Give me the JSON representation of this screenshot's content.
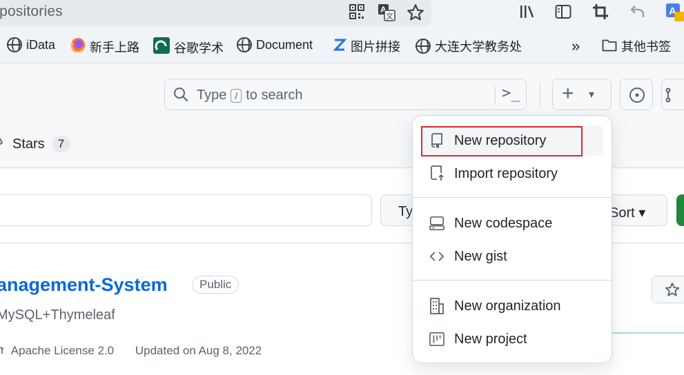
{
  "browser": {
    "url_fragment": "repositories",
    "bookmarks": [
      {
        "label": "iData",
        "icon": "globe-icon"
      },
      {
        "label": "新手上路",
        "icon": "firefox-icon"
      },
      {
        "label": "谷歌学术",
        "icon": "scholar-icon"
      },
      {
        "label": "Document",
        "icon": "globe-icon"
      },
      {
        "label": "图片拼接",
        "icon": "z-icon"
      },
      {
        "label": "大连大学教务处",
        "icon": "globe-icon"
      }
    ],
    "other_bookmarks": "其他书签",
    "overflow": "»"
  },
  "header": {
    "search_type": "Type",
    "search_key": "/",
    "search_rest": "to search",
    "command_icon": ">_",
    "plus": "+",
    "caret": "▾"
  },
  "tabs": {
    "stars_label": "Stars",
    "stars_count": "7"
  },
  "filters": {
    "type_label": "Ty",
    "sort_label": "Sort ▾"
  },
  "repo": {
    "name": "anagement-System",
    "visibility": "Public",
    "description": "MySQL+Thymeleaf",
    "license": "Apache License 2.0",
    "updated": "Updated on Aug 8, 2022"
  },
  "menu": {
    "items": [
      {
        "label": "New repository",
        "icon": "repo-icon"
      },
      {
        "label": "Import repository",
        "icon": "repo-push-icon"
      },
      {
        "label": "New codespace",
        "icon": "codespace-icon"
      },
      {
        "label": "New gist",
        "icon": "code-icon"
      },
      {
        "label": "New organization",
        "icon": "organization-icon"
      },
      {
        "label": "New project",
        "icon": "project-icon"
      }
    ]
  },
  "colors": {
    "link": "#0969da",
    "highlight": "#e0262b",
    "new_button": "#1f883d"
  }
}
